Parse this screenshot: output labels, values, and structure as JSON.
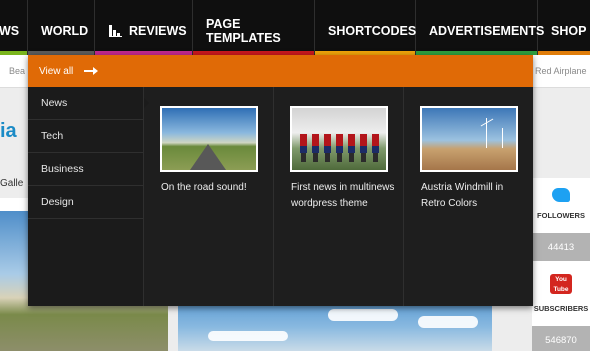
{
  "nav": {
    "items": [
      {
        "label": "WS",
        "color": "#7ab51d"
      },
      {
        "label": "WORLD",
        "color": "#5b5b5b"
      },
      {
        "label": "REVIEWS",
        "color": "#c1288f"
      },
      {
        "label": "PAGE TEMPLATES",
        "color": "#c8171d"
      },
      {
        "label": "SHORTCODES",
        "color": "#f0a30a"
      },
      {
        "label": "ADVERTISEMENTS",
        "color": "#2e9e3f"
      },
      {
        "label": "SHOP",
        "color": "#e07d0a"
      }
    ],
    "reviews_icon": "bar-chart-icon"
  },
  "dropdown": {
    "view_all": "View all",
    "accent": "#e06a06",
    "categories": [
      "News",
      "Tech",
      "Business",
      "Design"
    ],
    "posts": [
      {
        "title": "On the road sound!",
        "image": "road-photo"
      },
      {
        "title": "First news in multinews wordpress theme",
        "image": "football-team-photo"
      },
      {
        "title": "Austria Windmill in Retro Colors",
        "image": "windmill-photo"
      }
    ]
  },
  "background": {
    "breadcrumb_left": "Bea",
    "breadcrumb_right": "Red Airplane",
    "logo_fragment": "ia",
    "gallery_fragment": "Galle",
    "social": {
      "twitter_label": "FOLLOWERS",
      "twitter_count": "44413",
      "youtube_icon_text": "You Tube",
      "youtube_label": "SUBSCRIBERS",
      "youtube_count": "546870"
    }
  }
}
